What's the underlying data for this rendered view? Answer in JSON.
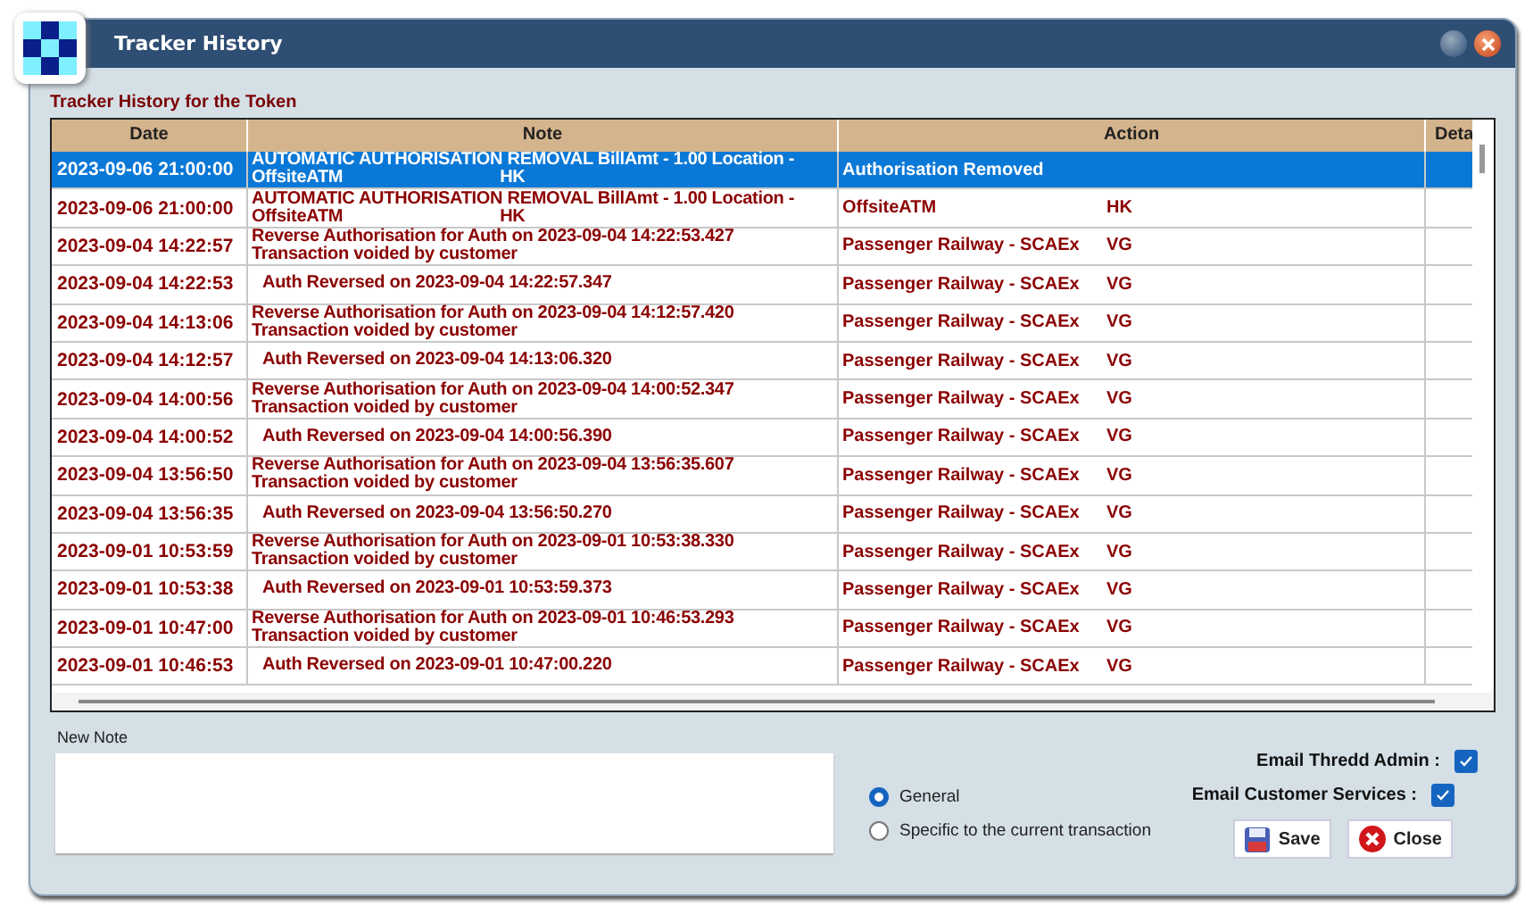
{
  "window": {
    "title": "Tracker History"
  },
  "table": {
    "title": "Tracker History for the Token",
    "columns": [
      "Date",
      "Note",
      "Action",
      "Deta"
    ],
    "rows": [
      {
        "date": "2023-09-06 21:00:00",
        "note": [
          [
            "AUTOMATIC AUTHORISATION REMOVAL BillAmt - 1.00 Location -"
          ],
          [
            "OffsiteATM",
            "HK"
          ]
        ],
        "action": [
          "Authorisation Removed"
        ],
        "selected": true
      },
      {
        "date": "2023-09-06 21:00:00",
        "note": [
          [
            "AUTOMATIC AUTHORISATION REMOVAL BillAmt - 1.00 Location -"
          ],
          [
            "OffsiteATM",
            "HK"
          ]
        ],
        "action": [
          "OffsiteATM",
          "HK"
        ],
        "selected": false
      },
      {
        "date": "2023-09-04 14:22:57",
        "note": [
          [
            "Reverse Authorisation for Auth on 2023-09-04 14:22:53.427"
          ],
          [
            "Transaction voided by customer"
          ]
        ],
        "action": [
          "Passenger Railway - SCAEx",
          "VG"
        ],
        "selected": false
      },
      {
        "date": "2023-09-04 14:22:53",
        "note": [
          [
            "Auth Reversed on 2023-09-04 14:22:57.347"
          ]
        ],
        "action": [
          "Passenger Railway - SCAEx",
          "VG"
        ],
        "selected": false
      },
      {
        "date": "2023-09-04 14:13:06",
        "note": [
          [
            "Reverse Authorisation for Auth on 2023-09-04 14:12:57.420"
          ],
          [
            "Transaction voided by customer"
          ]
        ],
        "action": [
          "Passenger Railway - SCAEx",
          "VG"
        ],
        "selected": false
      },
      {
        "date": "2023-09-04 14:12:57",
        "note": [
          [
            "Auth Reversed on 2023-09-04 14:13:06.320"
          ]
        ],
        "action": [
          "Passenger Railway - SCAEx",
          "VG"
        ],
        "selected": false
      },
      {
        "date": "2023-09-04 14:00:56",
        "note": [
          [
            "Reverse Authorisation for Auth on 2023-09-04 14:00:52.347"
          ],
          [
            "Transaction voided by customer"
          ]
        ],
        "action": [
          "Passenger Railway - SCAEx",
          "VG"
        ],
        "selected": false
      },
      {
        "date": "2023-09-04 14:00:52",
        "note": [
          [
            "Auth Reversed on 2023-09-04 14:00:56.390"
          ]
        ],
        "action": [
          "Passenger Railway - SCAEx",
          "VG"
        ],
        "selected": false
      },
      {
        "date": "2023-09-04 13:56:50",
        "note": [
          [
            "Reverse Authorisation for Auth on 2023-09-04 13:56:35.607"
          ],
          [
            "Transaction voided by customer"
          ]
        ],
        "action": [
          "Passenger Railway - SCAEx",
          "VG"
        ],
        "selected": false
      },
      {
        "date": "2023-09-04 13:56:35",
        "note": [
          [
            "Auth Reversed on 2023-09-04 13:56:50.270"
          ]
        ],
        "action": [
          "Passenger Railway - SCAEx",
          "VG"
        ],
        "selected": false
      },
      {
        "date": "2023-09-01 10:53:59",
        "note": [
          [
            "Reverse Authorisation for Auth on 2023-09-01 10:53:38.330"
          ],
          [
            "Transaction voided by customer"
          ]
        ],
        "action": [
          "Passenger Railway - SCAEx",
          "VG"
        ],
        "selected": false
      },
      {
        "date": "2023-09-01 10:53:38",
        "note": [
          [
            "Auth Reversed on 2023-09-01 10:53:59.373"
          ]
        ],
        "action": [
          "Passenger Railway - SCAEx",
          "VG"
        ],
        "selected": false
      },
      {
        "date": "2023-09-01 10:47:00",
        "note": [
          [
            "Reverse Authorisation for Auth on 2023-09-01 10:46:53.293"
          ],
          [
            "Transaction voided by customer"
          ]
        ],
        "action": [
          "Passenger Railway - SCAEx",
          "VG"
        ],
        "selected": false
      },
      {
        "date": "2023-09-01 10:46:53",
        "note": [
          [
            "Auth Reversed on 2023-09-01 10:47:00.220"
          ]
        ],
        "action": [
          "Passenger Railway - SCAEx",
          "VG"
        ],
        "selected": false
      }
    ]
  },
  "new_note": {
    "label": "New Note"
  },
  "scope": [
    {
      "label": "General",
      "selected": true
    },
    {
      "label": "Specific to the current transaction",
      "selected": false
    }
  ],
  "emails": [
    {
      "label": "Email Thredd Admin :",
      "checked": true
    },
    {
      "label": "Email Customer Services :",
      "checked": true
    }
  ],
  "buttons": [
    {
      "kind": "save",
      "label": "Save"
    },
    {
      "kind": "close",
      "label": "Close"
    }
  ]
}
